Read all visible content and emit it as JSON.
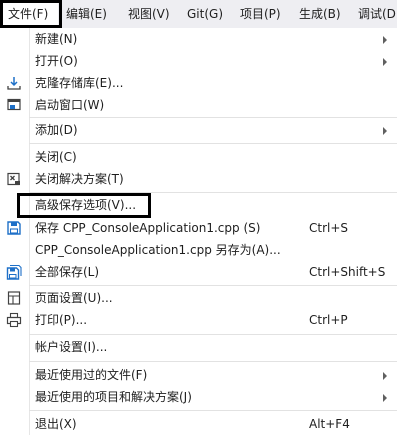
{
  "colors": {
    "menubar_bg": "#eeeef2",
    "menu_bg": "#ffffff",
    "text": "#1e1e1e",
    "icon_blue": "#1e70c8",
    "highlight_box": "#000000"
  },
  "menubar": {
    "items": [
      {
        "label": "文件(F)"
      },
      {
        "label": "编辑(E)"
      },
      {
        "label": "视图(V)"
      },
      {
        "label": "Git(G)"
      },
      {
        "label": "项目(P)"
      },
      {
        "label": "生成(B)"
      },
      {
        "label": "调试(D"
      }
    ]
  },
  "file_menu": {
    "items": [
      {
        "label": "新建(N)",
        "icon": null,
        "shortcut": "",
        "submenu": true
      },
      {
        "label": "打开(O)",
        "icon": null,
        "shortcut": "",
        "submenu": true
      },
      {
        "label": "克隆存储库(E)...",
        "icon": "clone-repository-icon",
        "shortcut": "",
        "submenu": false
      },
      {
        "label": "启动窗口(W)",
        "icon": "start-window-icon",
        "shortcut": "",
        "submenu": false
      },
      {
        "label": "添加(D)",
        "icon": null,
        "shortcut": "",
        "submenu": true
      },
      {
        "label": "关闭(C)",
        "icon": null,
        "shortcut": "",
        "submenu": false
      },
      {
        "label": "关闭解决方案(T)",
        "icon": "close-solution-icon",
        "shortcut": "",
        "submenu": false
      },
      {
        "label": "高级保存选项(V)...",
        "icon": null,
        "shortcut": "",
        "submenu": false
      },
      {
        "label": "保存 CPP_ConsoleApplication1.cpp (S)",
        "icon": "save-icon",
        "shortcut": "Ctrl+S",
        "submenu": false
      },
      {
        "label": "CPP_ConsoleApplication1.cpp 另存为(A)...",
        "icon": null,
        "shortcut": "",
        "submenu": false
      },
      {
        "label": "全部保存(L)",
        "icon": "save-all-icon",
        "shortcut": "Ctrl+Shift+S",
        "submenu": false
      },
      {
        "label": "页面设置(U)...",
        "icon": "page-setup-icon",
        "shortcut": "",
        "submenu": false
      },
      {
        "label": "打印(P)...",
        "icon": "printer-icon",
        "shortcut": "Ctrl+P",
        "submenu": false
      },
      {
        "label": "帐户设置(I)...",
        "icon": null,
        "shortcut": "",
        "submenu": false
      },
      {
        "label": "最近使用过的文件(F)",
        "icon": null,
        "shortcut": "",
        "submenu": true
      },
      {
        "label": "最近使用的项目和解决方案(J)",
        "icon": null,
        "shortcut": "",
        "submenu": true
      },
      {
        "label": "退出(X)",
        "icon": null,
        "shortcut": "Alt+F4",
        "submenu": false
      }
    ]
  }
}
